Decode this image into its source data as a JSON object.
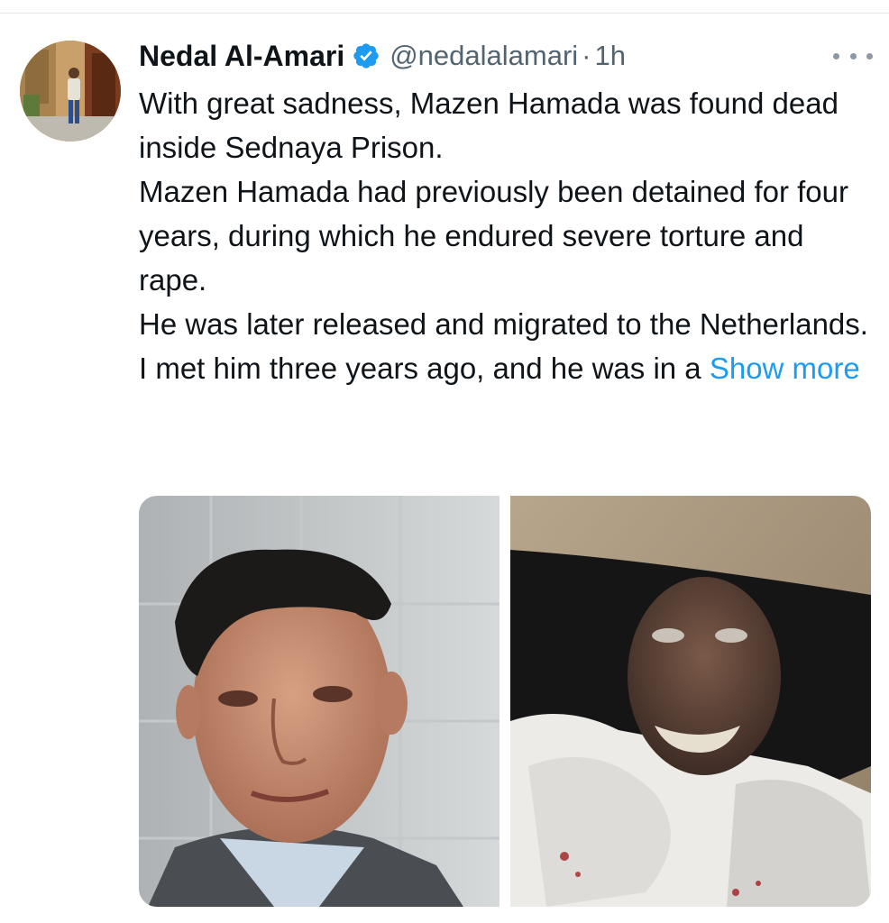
{
  "tweet": {
    "author_name": "Nedal Al-Amari",
    "handle": "@nedalalamari",
    "separator": "·",
    "time": "1h",
    "verified_icon": "verified-badge-icon",
    "more_icon": "more-horizontal-icon",
    "paragraphs": [
      "With great sadness, Mazen Hamada was found dead inside Sednaya Prison.",
      "Mazen Hamada had previously been detained for four years, during which he endured severe torture and rape.",
      "He was later released and migrated to the Netherlands."
    ],
    "last_line": "I met him three years ago, and he was in a",
    "show_more": "Show more"
  },
  "colors": {
    "link": "#1d9bf0",
    "secondary_text": "#536471",
    "verified": "#1d9bf0",
    "divider": "#e4e7ea"
  }
}
